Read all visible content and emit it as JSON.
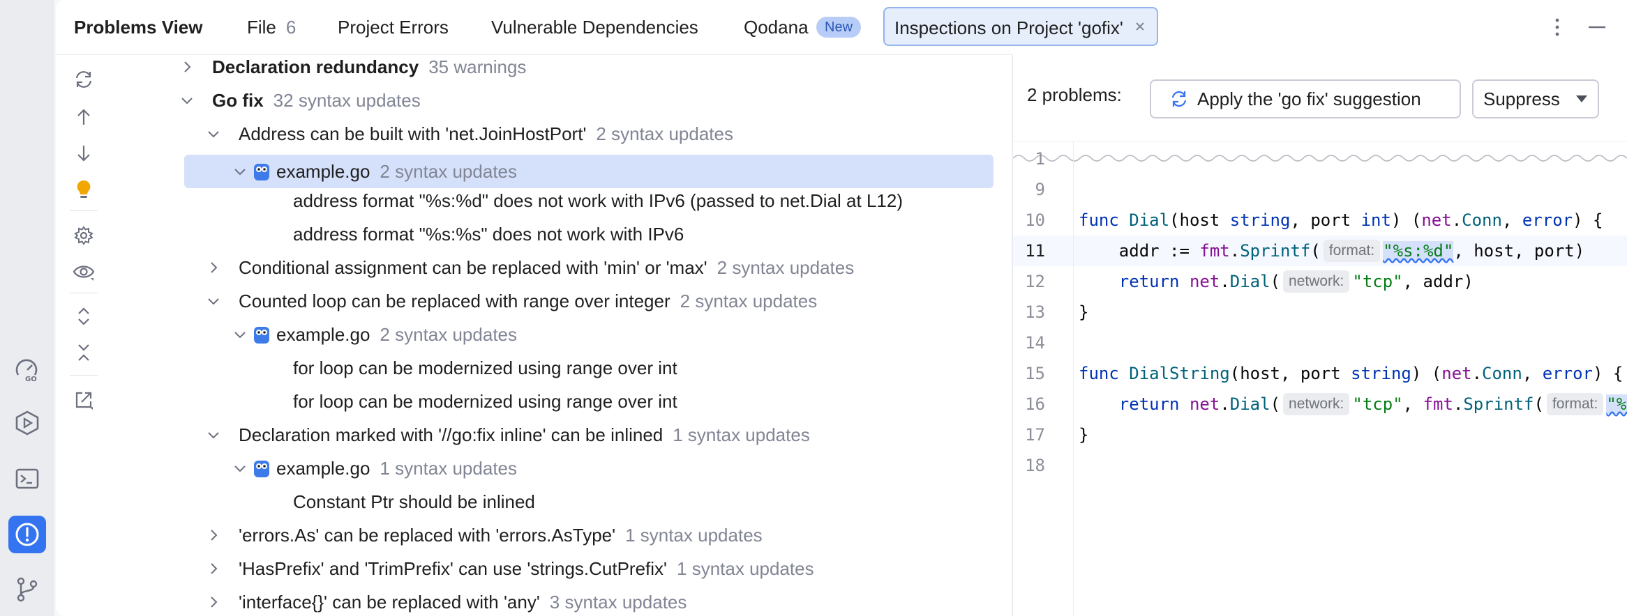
{
  "tabs": {
    "title": "Problems View",
    "file_label": "File",
    "file_count": "6",
    "project_errors": "Project Errors",
    "vulnerable": "Vulnerable Dependencies",
    "qodana": "Qodana",
    "qodana_badge": "New",
    "inspections": "Inspections on Project 'gofix'"
  },
  "tree": {
    "rows": [
      {
        "label": "Declaration redundancy",
        "meta": "35 warnings"
      },
      {
        "label": "Go fix",
        "meta": "32 syntax updates"
      },
      {
        "label": "Address can be built with 'net.JoinHostPort'",
        "meta": "2 syntax updates"
      },
      {
        "label": "example.go",
        "meta": "2 syntax updates"
      },
      {
        "label": "address format \"%s:%d\" does not work with IPv6 (passed to net.Dial at L12)"
      },
      {
        "label": "address format \"%s:%s\" does not work with IPv6"
      },
      {
        "label": "Conditional assignment can be replaced with 'min' or 'max'",
        "meta": "2 syntax updates"
      },
      {
        "label": "Counted loop can be replaced with range over integer",
        "meta": "2 syntax updates"
      },
      {
        "label": "example.go",
        "meta": "2 syntax updates"
      },
      {
        "label": "for loop can be modernized using range over int"
      },
      {
        "label": "for loop can be modernized using range over int"
      },
      {
        "label": "Declaration marked with '//go:fix inline' can be inlined",
        "meta": "1 syntax updates"
      },
      {
        "label": "example.go",
        "meta": "1 syntax updates"
      },
      {
        "label": "Constant Ptr should be inlined"
      },
      {
        "label": "'errors.As' can be replaced with 'errors.AsType'",
        "meta": "1 syntax updates"
      },
      {
        "label": "'HasPrefix' and 'TrimPrefix' can use 'strings.CutPrefix'",
        "meta": "1 syntax updates"
      },
      {
        "label": "'interface{}' can be replaced with 'any'",
        "meta": "3 syntax updates"
      }
    ]
  },
  "details": {
    "problems_count": "2 problems:",
    "apply_button": "Apply the 'go fix' suggestion",
    "suppress_button": "Suppress"
  },
  "editor": {
    "line_numbers": [
      "1",
      "9",
      "10",
      "11",
      "12",
      "13",
      "14",
      "15",
      "16",
      "17",
      "18"
    ],
    "hint_format": "format:",
    "hint_network": "network:",
    "l10_func": "func",
    "l10_name": "Dial",
    "l10_p1": "(host ",
    "l10_t1": "string",
    "l10_p2": ", port ",
    "l10_t2": "int",
    "l10_p3": ") (",
    "l10_pkg1": "net",
    "l10_dot": ".",
    "l10_conn": "Conn",
    "l10_comma": ", ",
    "l10_err": "error",
    "l10_end": ") {",
    "l11_a": "    addr := ",
    "l11_pkg": "fmt",
    "l11_dot": ".",
    "l11_fn": "Sprintf",
    "l11_paren": "(",
    "l11_str": "\"%s:%d\"",
    "l11_rest": ", host, port)",
    "l12_ret": "    return",
    "l12_sp": " ",
    "l12_pkg": "net",
    "l12_dot": ".",
    "l12_fn": "Dial",
    "l12_paren": "(",
    "l12_str": "\"tcp\"",
    "l12_rest": ", addr)",
    "l13": "}",
    "l15_func": "func",
    "l15_name": "DialString",
    "l15_p1": "(host, port ",
    "l15_t1": "string",
    "l15_p2": ") (",
    "l15_pkg1": "net",
    "l15_dot": ".",
    "l15_conn": "Conn",
    "l15_comma": ", ",
    "l15_err": "error",
    "l15_end": ") {",
    "l16_ret": "    return",
    "l16_sp": " ",
    "l16_pkg": "net",
    "l16_dot": ".",
    "l16_fn": "Dial",
    "l16_paren": "(",
    "l16_str": "\"tcp\"",
    "l16_comma": ", ",
    "l16_pkg2": "fmt",
    "l16_dot2": ".",
    "l16_fn2": "Sprintf",
    "l16_paren2": "(",
    "l16_str2": "\"%s:%s\"",
    "l17": "}"
  },
  "colors": {
    "accent": "#3574f0",
    "selection": "#d5e1fb",
    "keyword": "#0033b3",
    "string": "#067d17",
    "muted": "#818594"
  }
}
